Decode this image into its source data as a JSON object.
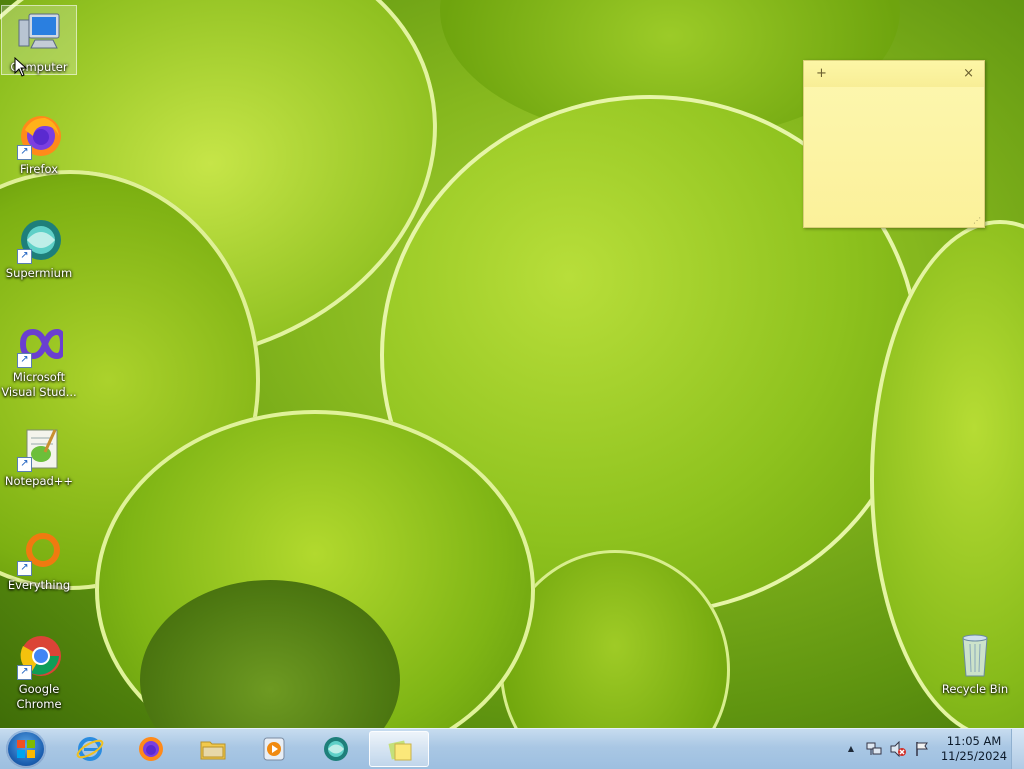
{
  "desktop": {
    "icons": [
      {
        "label": "Computer",
        "icon": "computer-icon",
        "selected": true
      },
      {
        "label": "Firefox",
        "icon": "firefox-icon"
      },
      {
        "label": "Supermium",
        "icon": "supermium-icon"
      },
      {
        "label": "Microsoft Visual Stud...",
        "icon": "visual-studio-icon"
      },
      {
        "label": "Notepad++",
        "icon": "notepad-plus-plus-icon"
      },
      {
        "label": "Everything",
        "icon": "everything-search-icon"
      },
      {
        "label": "Google Chrome",
        "icon": "chrome-icon"
      }
    ],
    "recycle_bin": {
      "label": "Recycle Bin",
      "icon": "recycle-bin-icon"
    }
  },
  "sticky_note": {
    "add_glyph": "+",
    "close_glyph": "×",
    "text": ""
  },
  "taskbar": {
    "start": {
      "icon": "windows-start-orb-icon"
    },
    "pinned": [
      {
        "name": "internet-explorer",
        "icon": "internet-explorer-icon"
      },
      {
        "name": "firefox",
        "icon": "firefox-icon"
      },
      {
        "name": "file-explorer",
        "icon": "folder-icon"
      },
      {
        "name": "media-player",
        "icon": "media-player-icon"
      },
      {
        "name": "supermium",
        "icon": "supermium-icon"
      },
      {
        "name": "sticky-notes",
        "icon": "sticky-notes-icon",
        "active": true
      }
    ],
    "tray": {
      "show_hidden_glyph": "▲",
      "icons": [
        "network-icon",
        "volume-muted-icon",
        "action-center-flag-icon"
      ]
    },
    "clock": {
      "time": "11:05 AM",
      "date": "11/25/2024"
    }
  },
  "colors": {
    "taskbar": "#a9c7e4",
    "sticky": "#fbf19a",
    "wallpaper": "#86b81e"
  }
}
